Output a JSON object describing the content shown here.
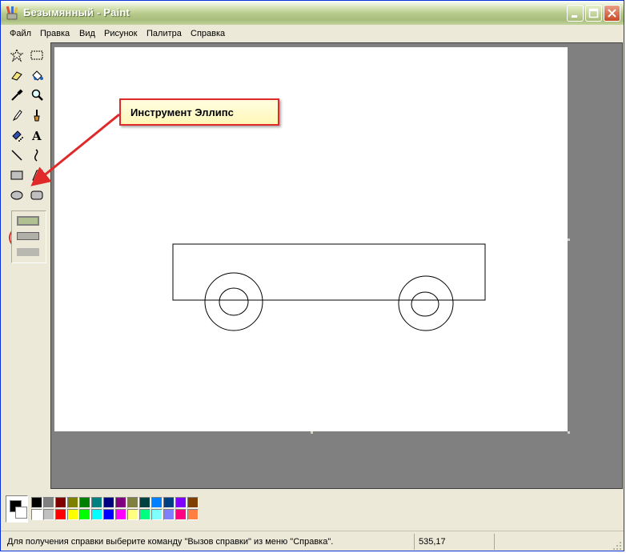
{
  "window": {
    "title": "Безымянный - Paint"
  },
  "menu": {
    "items": [
      "Файл",
      "Правка",
      "Вид",
      "Рисунок",
      "Палитра",
      "Справка"
    ]
  },
  "tools": [
    {
      "name": "free-select-tool",
      "icon": "star-select-icon"
    },
    {
      "name": "rect-select-tool",
      "icon": "dashed-rect-icon"
    },
    {
      "name": "eraser-tool",
      "icon": "eraser-icon"
    },
    {
      "name": "fill-tool",
      "icon": "paint-bucket-icon"
    },
    {
      "name": "color-picker-tool",
      "icon": "eyedropper-icon"
    },
    {
      "name": "magnifier-tool",
      "icon": "magnifier-icon"
    },
    {
      "name": "pencil-tool",
      "icon": "pencil-icon"
    },
    {
      "name": "brush-tool",
      "icon": "brush-icon"
    },
    {
      "name": "airbrush-tool",
      "icon": "airbrush-icon"
    },
    {
      "name": "text-tool",
      "icon": "text-a-icon"
    },
    {
      "name": "line-tool",
      "icon": "line-icon"
    },
    {
      "name": "curve-tool",
      "icon": "curve-icon"
    },
    {
      "name": "rectangle-tool",
      "icon": "rectangle-icon"
    },
    {
      "name": "polygon-tool",
      "icon": "polygon-icon"
    },
    {
      "name": "ellipse-tool",
      "icon": "ellipse-icon"
    },
    {
      "name": "rounded-rect-tool",
      "icon": "rounded-rect-icon"
    }
  ],
  "callout": {
    "text": "Инструмент Эллипс"
  },
  "palette": {
    "foreground": "#000000",
    "background": "#ffffff",
    "top_row": [
      "#000000",
      "#808080",
      "#800000",
      "#808000",
      "#008000",
      "#008080",
      "#000080",
      "#800080",
      "#808040",
      "#004040",
      "#0080ff",
      "#004080",
      "#8000ff",
      "#804000"
    ],
    "bottom_row": [
      "#ffffff",
      "#c0c0c0",
      "#ff0000",
      "#ffff00",
      "#00ff00",
      "#00ffff",
      "#0000ff",
      "#ff00ff",
      "#ffff80",
      "#00ff80",
      "#80ffff",
      "#8080ff",
      "#ff0080",
      "#ff8040"
    ]
  },
  "status": {
    "help_text": "Для получения справки выберите команду \"Вызов справки\" из меню \"Справка\".",
    "coordinates": "535,17"
  },
  "colors": {
    "highlight": "#e02a2a",
    "callout_bg": "#fff7b8"
  }
}
